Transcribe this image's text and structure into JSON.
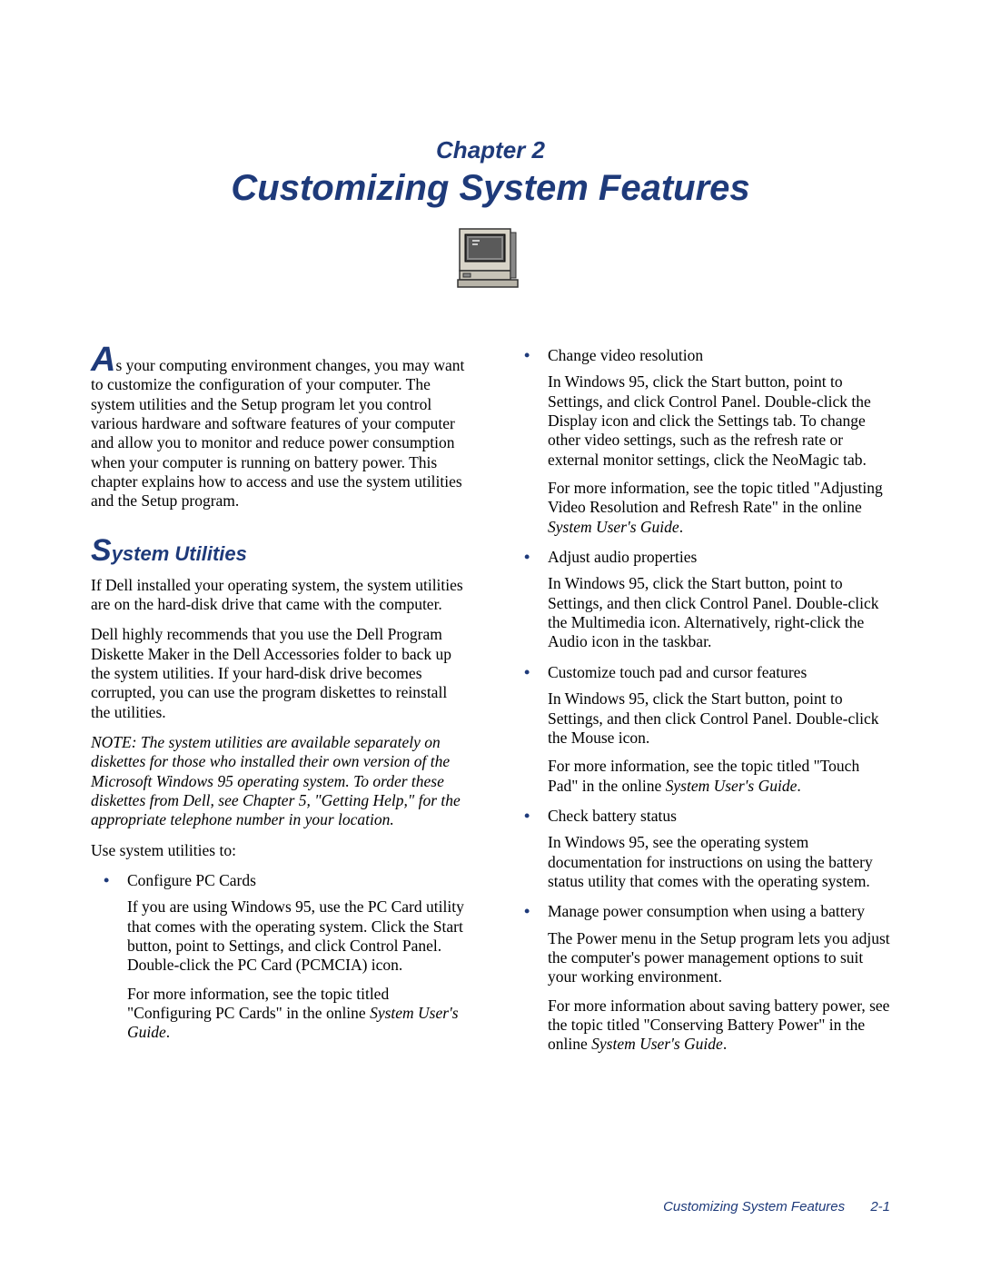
{
  "chapter": {
    "label": "Chapter 2",
    "title": "Customizing System Features"
  },
  "intro": {
    "dropcap": "A",
    "rest": "s your computing environment changes, you may want to customize the configuration of your computer. The system utilities and the Setup program let you control various hardware and software features of your computer and allow you to monitor and reduce power consumption when your computer is running on battery power. This chapter explains how to access and use the system utilities and the Setup program."
  },
  "section": {
    "heading_first": "S",
    "heading_rest": "ystem Utilities",
    "p1": "If Dell installed your operating system, the system utilities are on the hard-disk drive that came with the computer.",
    "p2": "Dell highly recommends that you use the Dell Program Diskette Maker in the Dell Accessories folder to back up the system utilities. If your hard-disk drive becomes corrupted, you can use the program diskettes to reinstall the utilities.",
    "note": "NOTE: The system utilities are available separately on diskettes for those who installed their own version of the Microsoft Windows 95 operating system. To order these diskettes from Dell, see Chapter 5, \"Getting Help,\" for the appropriate telephone number in your location.",
    "lead": "Use system utilities to:"
  },
  "bullets": [
    {
      "title": "Configure PC Cards",
      "paras": [
        "If you are using Windows 95, use the PC Card utility that comes with the operating system. Click the Start button, point to Settings, and click Control Panel. Double-click the PC Card (PCMCIA) icon.",
        "For more information, see the topic titled \"Configuring PC Cards\" in the online <i>System User's Guide</i>."
      ]
    },
    {
      "title": "Change video resolution",
      "paras": [
        "In Windows 95, click the Start button, point to Settings, and click Control Panel. Double-click the Display icon and click the Settings tab. To change other video settings, such as the refresh rate or external monitor settings, click the NeoMagic tab.",
        "For more information, see the topic titled \"Adjusting Video Resolution and Refresh Rate\" in the online <i>System User's Guide</i>."
      ]
    },
    {
      "title": "Adjust audio properties",
      "paras": [
        "In Windows 95, click the Start button, point to Settings, and then click Control Panel. Double-click the Multimedia icon. Alternatively, right-click the Audio icon in the taskbar."
      ]
    },
    {
      "title": "Customize touch pad and cursor features",
      "paras": [
        "In Windows 95, click the Start button, point to Settings, and then click Control Panel. Double-click the Mouse icon.",
        "For more information, see the topic titled \"Touch Pad\" in the online <i>System User's Guide</i>."
      ]
    },
    {
      "title": "Check battery status",
      "paras": [
        "In Windows 95, see the operating system documentation for instructions on using the battery status utility that comes with the operating system."
      ]
    },
    {
      "title": "Manage power consumption when using a battery",
      "paras": [
        "The Power menu in the Setup program lets you adjust the computer's power management options to suit your working environment.",
        "For more information about saving battery power, see the topic titled \"Conserving Battery Power\" in the online <i>System User's Guide</i>."
      ]
    }
  ],
  "footer": {
    "text": "Customizing System Features",
    "page": "2-1"
  }
}
